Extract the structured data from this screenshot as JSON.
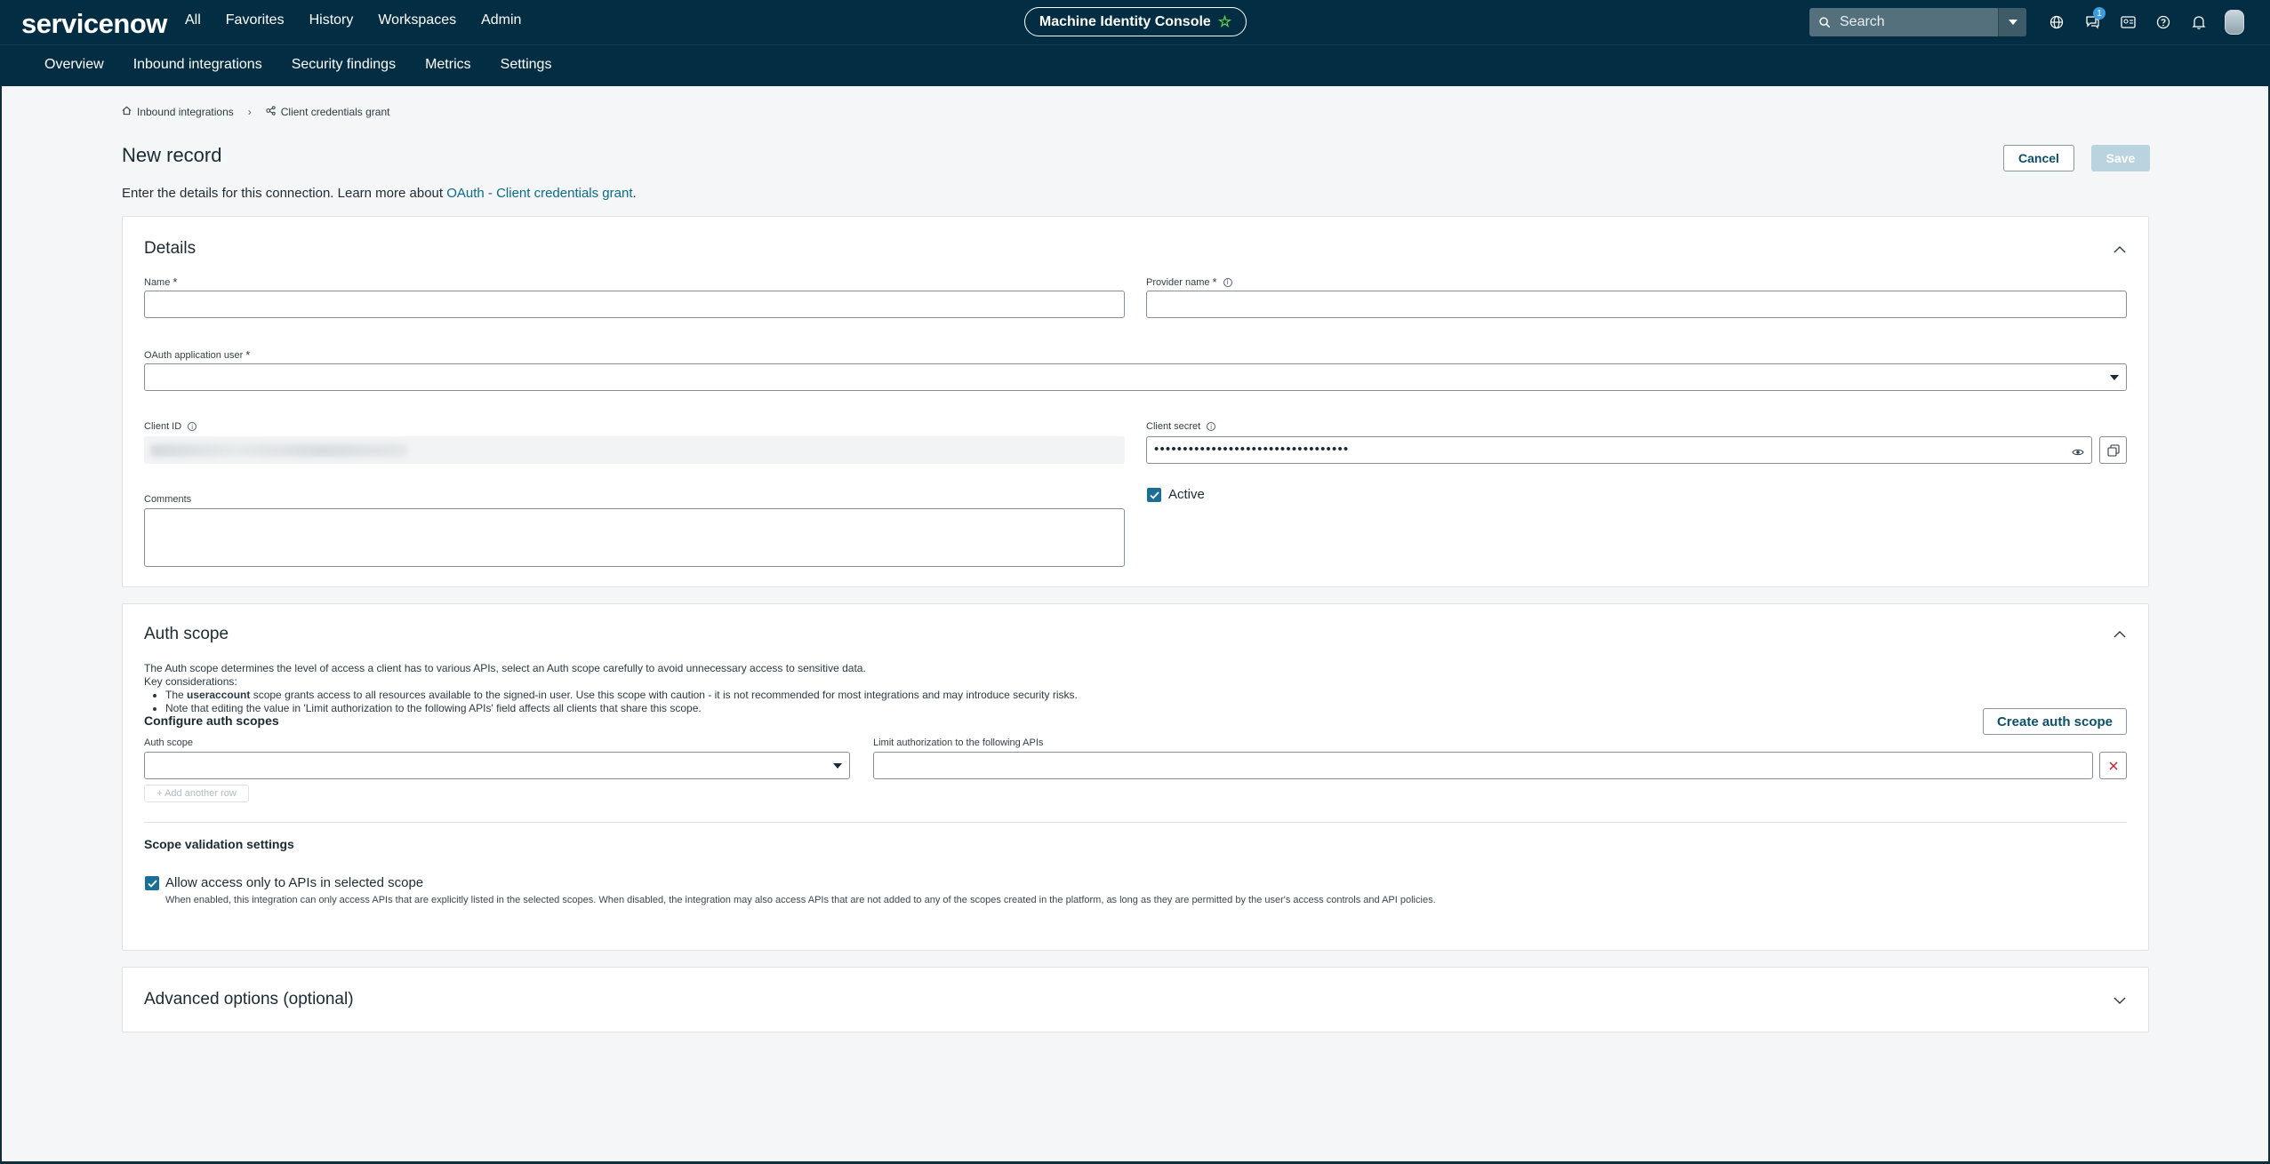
{
  "brand": {
    "logo_text": "servicenow"
  },
  "top_nav": {
    "items": [
      "All",
      "Favorites",
      "History",
      "Workspaces",
      "Admin"
    ]
  },
  "console": {
    "label": "Machine Identity Console"
  },
  "search": {
    "placeholder": "Search"
  },
  "notifications": {
    "badge_count": "1"
  },
  "sub_nav": {
    "tabs": [
      "Overview",
      "Inbound integrations",
      "Security findings",
      "Metrics",
      "Settings"
    ]
  },
  "breadcrumb": {
    "parent": "Inbound integrations",
    "current": "Client credentials grant"
  },
  "page": {
    "title": "New record",
    "intro_text": "Enter the details for this connection. Learn more about ",
    "intro_link": "OAuth - Client credentials grant",
    "intro_end": ".",
    "cancel_label": "Cancel",
    "save_label": "Save"
  },
  "details": {
    "title": "Details",
    "name_label": "Name",
    "provider_label": "Provider name",
    "oauth_user_label": "OAuth application user",
    "client_id_label": "Client ID",
    "client_secret_label": "Client secret",
    "client_secret_value": "••••••••••••••••••••••••••••••••••",
    "comments_label": "Comments",
    "active_label": "Active",
    "required_marker": "*"
  },
  "auth_scope": {
    "title": "Auth scope",
    "description": "The Auth scope determines the level of access a client has to various APIs, select an Auth scope carefully to avoid unnecessary access to sensitive data.",
    "key_considerations": "Key considerations:",
    "bullet1_pre": "The ",
    "bullet1_bold": "useraccount",
    "bullet1_post": " scope grants access to all resources available to the signed-in user. Use this scope with caution - it is not recommended for most integrations and may introduce security risks.",
    "bullet2": "Note that editing the value in 'Limit authorization to the following APIs' field affects all clients that share this scope.",
    "configure_heading": "Configure auth scopes",
    "create_button": "Create auth scope",
    "auth_scope_label": "Auth scope",
    "limit_label": "Limit authorization to the following APIs",
    "add_row": "+ Add another row",
    "validation_heading": "Scope validation settings",
    "allow_label": "Allow access only to APIs in selected scope",
    "allow_note": "When enabled, this integration can only access APIs that are explicitly listed in the selected scopes. When disabled, the integration may also access APIs that are not added to any of the scopes created in the platform, as long as they are permitted by the user's access controls and API policies."
  },
  "advanced": {
    "title": "Advanced options (optional)"
  },
  "colors": {
    "header_bg": "#032d42",
    "accent": "#1b6f96",
    "link": "#0b6a8c"
  }
}
